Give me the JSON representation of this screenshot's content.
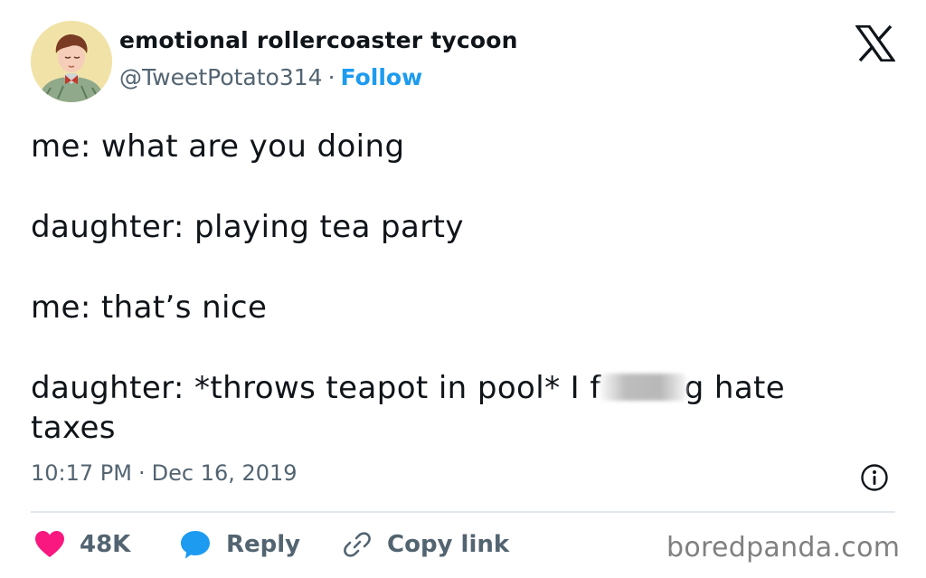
{
  "author": {
    "display_name": "emotional rollercoaster tycoon",
    "handle": "@TweetPotato314",
    "separator": "·",
    "follow_label": "Follow"
  },
  "tweet": {
    "lines": [
      "me: what are you doing",
      "daughter: playing tea party",
      "me: that’s nice"
    ],
    "last_line_prefix": "daughter: *throws teapot in pool* I f",
    "last_line_suffix": "g hate taxes"
  },
  "meta": {
    "time": "10:17 PM",
    "separator": "·",
    "date": "Dec 16, 2019"
  },
  "actions": {
    "like_count": "48K",
    "reply_label": "Reply",
    "copy_label": "Copy link"
  },
  "watermark": "boredpanda.com",
  "colors": {
    "like": "#f91880",
    "reply": "#1d9bf0",
    "follow": "#1d9bf0",
    "muted": "#536471"
  },
  "icons": {
    "brand": "x-logo-icon",
    "like": "heart-icon",
    "reply": "speech-bubble-icon",
    "copy": "link-icon",
    "info": "info-icon"
  }
}
